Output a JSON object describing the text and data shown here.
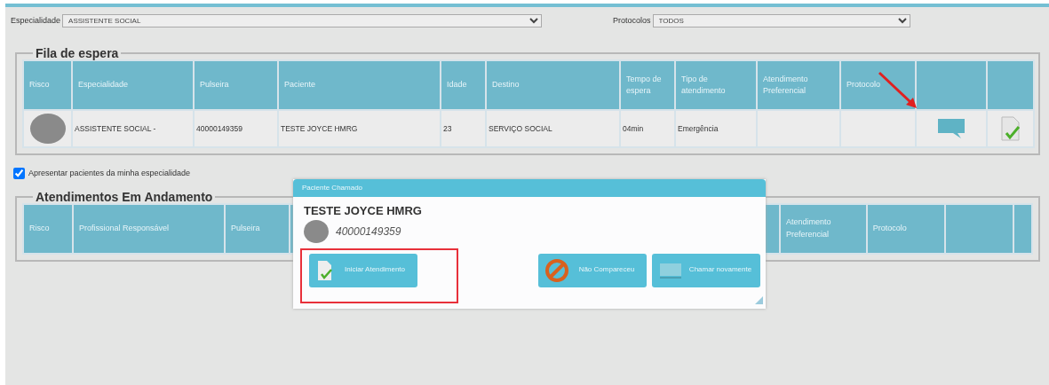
{
  "filters": [
    {
      "label": "Especialidade",
      "value": "ASSISTENTE SOCIAL"
    },
    {
      "label": "Protocolos",
      "value": "TODOS"
    }
  ],
  "queue": {
    "title": "Fila de espera",
    "columns": [
      "Risco",
      "Especialidade",
      "Pulseira",
      "Paciente",
      "Idade",
      "Destino",
      "Tempo de espera",
      "Tipo de atendimento",
      "Atendimento Preferencial",
      "Protocolo",
      "",
      ""
    ],
    "rows": [
      {
        "cells": [
          "",
          "ASSISTENTE SOCIAL -",
          "40000149359",
          "TESTE JOYCE HMRG",
          "23",
          "SERVIÇO SOCIAL",
          "04min",
          "Emergência",
          "",
          "",
          "",
          ""
        ]
      }
    ]
  },
  "my_specialty": {
    "label": "Apresentar pacientes da minha especialidade",
    "checked": true
  },
  "in_progress": {
    "title": "Atendimentos Em Andamento",
    "columns": [
      "Risco",
      "Profissional Responsável",
      "Pulseira",
      "",
      "Atendimento Preferencial",
      "Protocolo",
      "",
      ""
    ]
  },
  "dialog": {
    "title": "Paciente Chamado",
    "patient": "TESTE JOYCE HMRG",
    "bracelet": "40000149359",
    "buttons": [
      {
        "kind": "start",
        "label": "Iniciar Atendimento",
        "highlighted": true
      },
      {
        "kind": "absent",
        "label": "Não Compareceu",
        "highlighted": false
      },
      {
        "kind": "recall",
        "label": "Chamar novamente",
        "highlighted": false
      }
    ]
  }
}
